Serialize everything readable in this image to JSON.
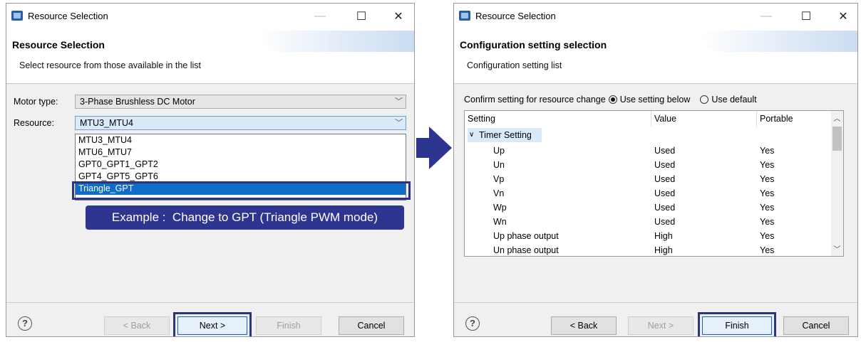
{
  "left": {
    "title": "Resource Selection",
    "heading": "Resource Selection",
    "subtitle": "Select resource from those available in the list",
    "motor_label": "Motor type:",
    "motor_value": "3-Phase Brushless DC Motor",
    "resource_label": "Resource:",
    "resource_value": "MTU3_MTU4",
    "options": [
      "MTU3_MTU4",
      "MTU6_MTU7",
      "GPT0_GPT1_GPT2",
      "GPT4_GPT5_GPT6",
      "Triangle_GPT"
    ],
    "callout": "Example :  Change to GPT (Triangle PWM mode)",
    "buttons": {
      "back": "< Back",
      "next": "Next >",
      "finish": "Finish",
      "cancel": "Cancel"
    }
  },
  "right": {
    "title": "Resource Selection",
    "heading": "Configuration setting selection",
    "subtitle": "Configuration setting list",
    "confirm_label": "Confirm setting for resource change",
    "radio_below": "Use setting below",
    "radio_default": "Use default",
    "columns": [
      "Setting",
      "Value",
      "Portable"
    ],
    "group": "Timer Setting",
    "rows": [
      {
        "setting": "Up",
        "value": "Used",
        "portable": "Yes"
      },
      {
        "setting": "Un",
        "value": "Used",
        "portable": "Yes"
      },
      {
        "setting": "Vp",
        "value": "Used",
        "portable": "Yes"
      },
      {
        "setting": "Vn",
        "value": "Used",
        "portable": "Yes"
      },
      {
        "setting": "Wp",
        "value": "Used",
        "portable": "Yes"
      },
      {
        "setting": "Wn",
        "value": "Used",
        "portable": "Yes"
      },
      {
        "setting": "Up phase output",
        "value": "High",
        "portable": "Yes"
      },
      {
        "setting": "Un phase output",
        "value": "High",
        "portable": "Yes"
      }
    ],
    "buttons": {
      "back": "< Back",
      "next": "Next >",
      "finish": "Finish",
      "cancel": "Cancel"
    }
  },
  "colors": {
    "accent": "#2d3590",
    "selection": "#0f6cc8"
  }
}
